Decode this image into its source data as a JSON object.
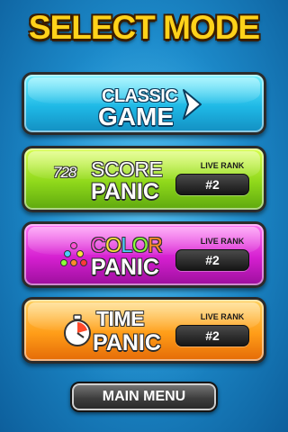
{
  "screen": {
    "title": "SELECT MODE"
  },
  "modes": [
    {
      "id": "classic",
      "title_top": "CLASSIC",
      "title_bottom": "GAME",
      "color": "#1fb9e6"
    },
    {
      "id": "score",
      "deco_text": "728",
      "title_top": "SCORE",
      "title_bottom": "PANIC",
      "rank_label": "LIVE RANK",
      "rank_value": "#2",
      "color": "#8fd81b"
    },
    {
      "id": "color",
      "title_top_letters": [
        "C",
        "O",
        "L",
        "O",
        "R"
      ],
      "title_top_colors": [
        "#ff4fd6",
        "#ffe23b",
        "#4ad0ff",
        "#8cff3a",
        "#ff8a2a"
      ],
      "title_bottom": "PANIC",
      "rank_label": "LIVE RANK",
      "rank_value": "#2",
      "color": "#d51fd0"
    },
    {
      "id": "time",
      "title_top": "TIME",
      "title_bottom": "PANIC",
      "rank_label": "LIVE RANK",
      "rank_value": "#2",
      "color": "#ff9d18"
    }
  ],
  "footer": {
    "main_menu_label": "MAIN MENU"
  },
  "icons": {
    "classic_arrow": "arrow-right-icon",
    "color_dots": "color-dots-icon",
    "time_timer": "timer-icon"
  },
  "colors": {
    "title": "#ffd21a",
    "background": "#1d8ccc"
  }
}
